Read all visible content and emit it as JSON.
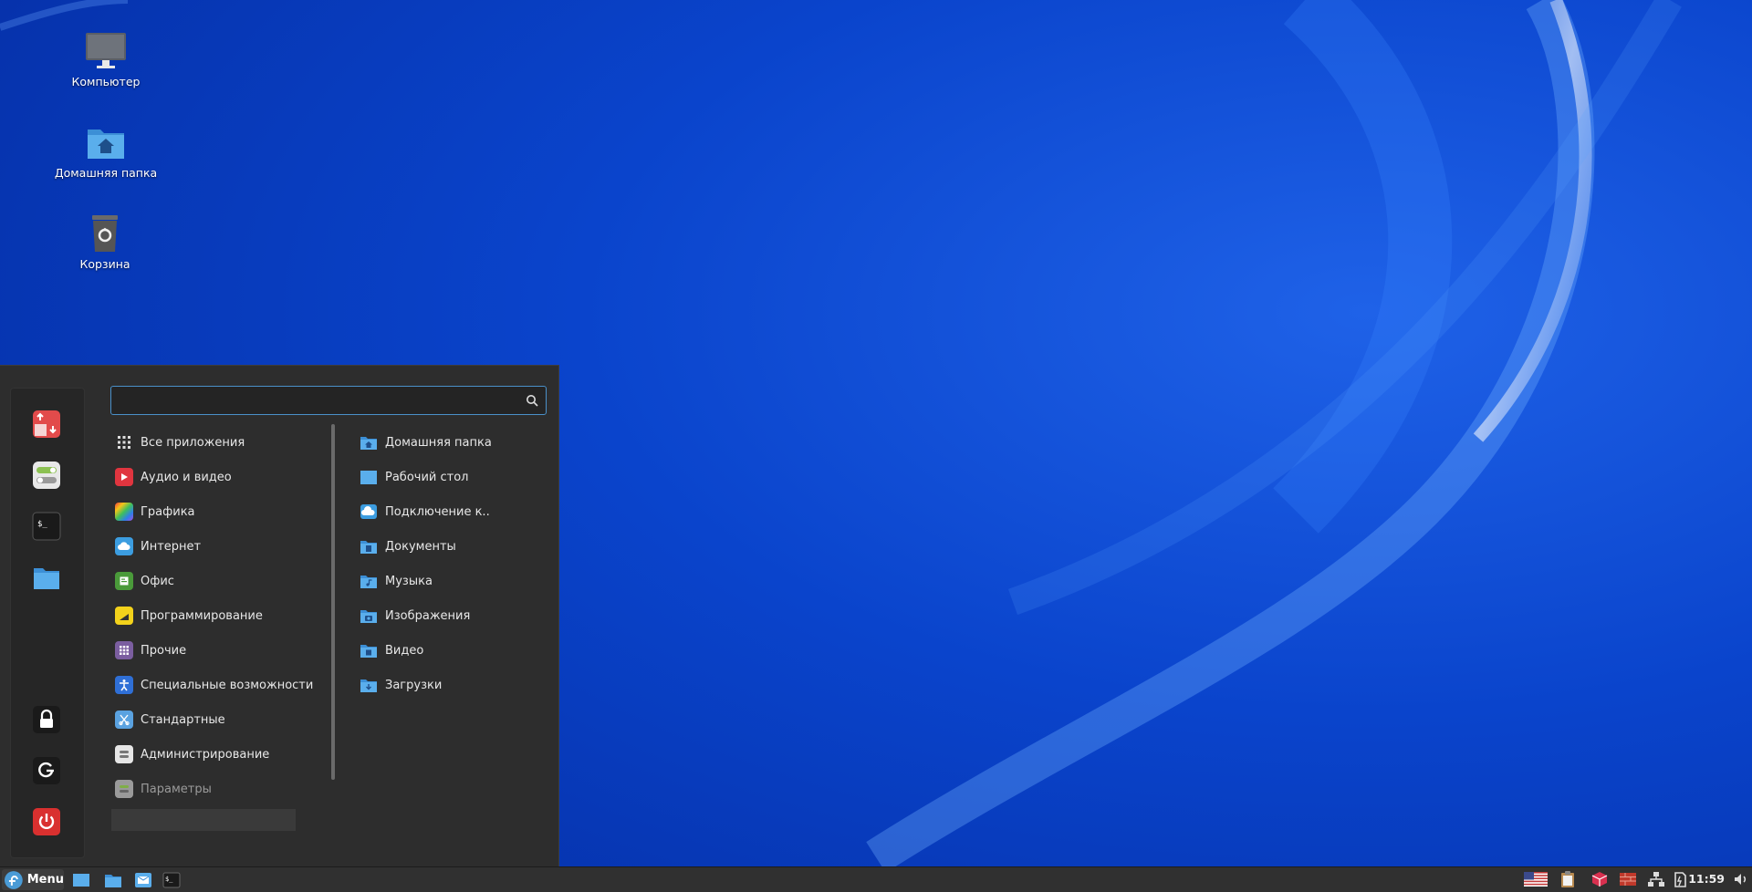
{
  "desktop": {
    "icons": [
      {
        "label": "Компьютер",
        "icon": "monitor-icon"
      },
      {
        "label": "Домашняя папка",
        "icon": "home-folder-icon"
      },
      {
        "label": "Корзина",
        "icon": "trash-icon"
      }
    ]
  },
  "menu": {
    "search": {
      "placeholder": "",
      "value": ""
    },
    "favorites": [
      {
        "name": "software-manager-icon"
      },
      {
        "name": "settings-toggle-icon"
      },
      {
        "name": "terminal-icon"
      },
      {
        "name": "files-folder-icon"
      },
      {
        "name": "lock-screen-icon"
      },
      {
        "name": "logout-icon"
      },
      {
        "name": "power-icon"
      }
    ],
    "categories": [
      {
        "label": "Все приложения",
        "icon": "grid-icon"
      },
      {
        "label": "Аудио и видео",
        "icon": "play-icon"
      },
      {
        "label": "Графика",
        "icon": "palette-icon"
      },
      {
        "label": "Интернет",
        "icon": "cloud-icon"
      },
      {
        "label": "Офис",
        "icon": "office-icon"
      },
      {
        "label": "Программирование",
        "icon": "programming-icon"
      },
      {
        "label": "Прочие",
        "icon": "other-icon"
      },
      {
        "label": "Специальные возможности",
        "icon": "accessibility-icon"
      },
      {
        "label": "Стандартные",
        "icon": "accessories-icon"
      },
      {
        "label": "Администрирование",
        "icon": "administration-icon"
      },
      {
        "label": "Параметры",
        "icon": "preferences-icon"
      }
    ],
    "places": [
      {
        "label": "Домашняя папка",
        "icon": "home-folder-icon"
      },
      {
        "label": "Рабочий стол",
        "icon": "desktop-folder-icon"
      },
      {
        "label": "Подключение к..",
        "icon": "network-cloud-icon"
      },
      {
        "label": "Документы",
        "icon": "documents-folder-icon"
      },
      {
        "label": "Музыка",
        "icon": "music-folder-icon"
      },
      {
        "label": "Изображения",
        "icon": "pictures-folder-icon"
      },
      {
        "label": "Видео",
        "icon": "videos-folder-icon"
      },
      {
        "label": "Загрузки",
        "icon": "downloads-folder-icon"
      }
    ]
  },
  "taskbar": {
    "menu_label": "Menu",
    "clock": "11:59"
  }
}
